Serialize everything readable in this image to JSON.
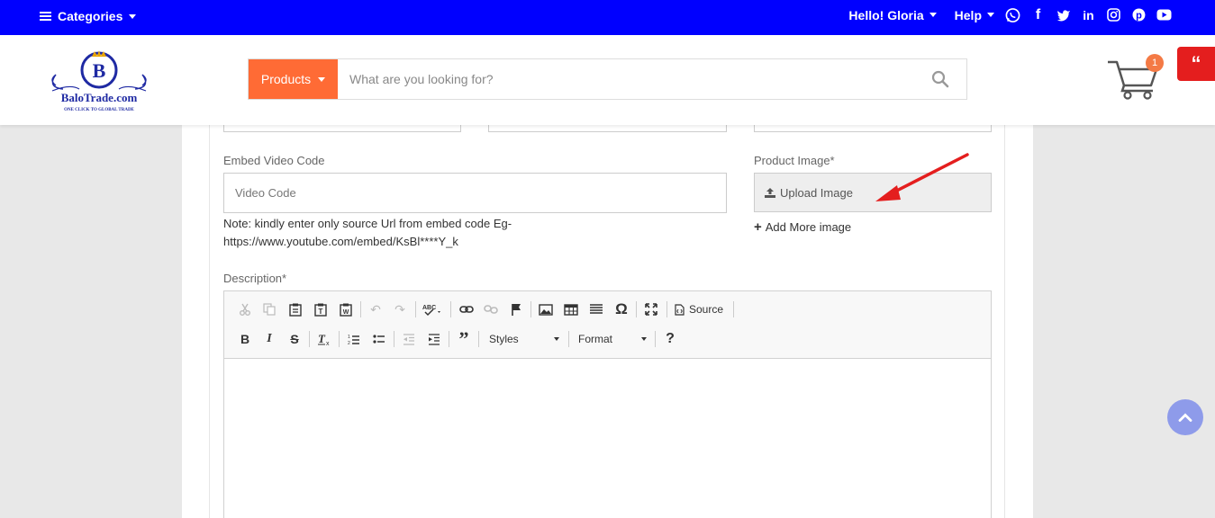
{
  "topbar": {
    "categories_label": "Categories",
    "greeting": "Hello! Gloria",
    "help_label": "Help",
    "social": [
      "whatsapp-icon",
      "facebook-icon",
      "twitter-icon",
      "linkedin-icon",
      "instagram-icon",
      "pinterest-icon",
      "youtube-icon"
    ]
  },
  "header": {
    "logo_text": "BaloTrade.com",
    "logo_tagline": "ONE CLICK TO GLOBAL TRADE",
    "search_category": "Products",
    "search_placeholder": "What are you looking for?",
    "cart_count": "1"
  },
  "form": {
    "video_label": "Embed Video Code",
    "video_placeholder": "Video Code",
    "note_line1": "Note: kindly enter only source Url from embed code Eg-",
    "note_line2": "https://www.youtube.com/embed/KsBl****Y_k",
    "image_label": "Product Image*",
    "upload_label": "Upload Image",
    "add_more_label": "Add More image",
    "description_label": "Description*"
  },
  "editor": {
    "source_label": "Source",
    "styles_label": "Styles",
    "format_label": "Format"
  },
  "colors": {
    "topbar": "#0000ff",
    "accent": "#ff6b35",
    "quote": "#e41e1e",
    "arrow": "#e41e1e"
  }
}
